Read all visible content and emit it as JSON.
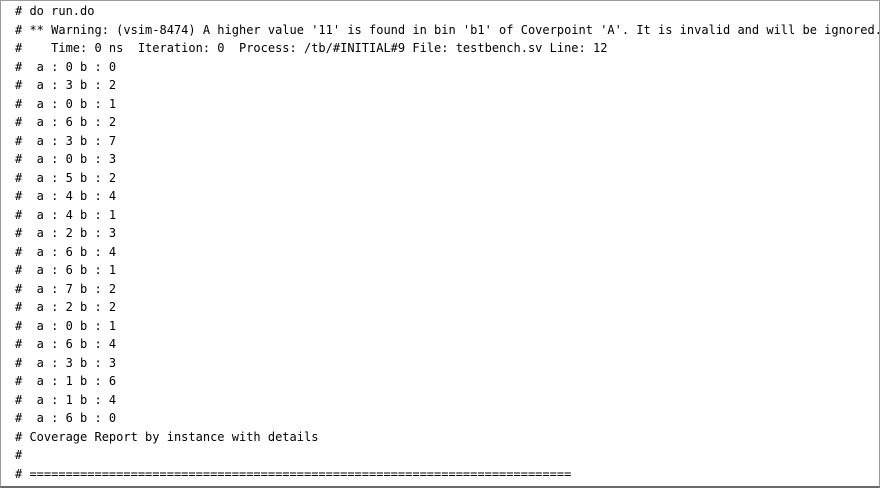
{
  "console": {
    "lines": [
      "# do run.do",
      "# ** Warning: (vsim-8474) A higher value '11' is found in bin 'b1' of Coverpoint 'A'. It is invalid and will be ignored.",
      "#    Time: 0 ns  Iteration: 0  Process: /tb/#INITIAL#9 File: testbench.sv Line: 12",
      "#  a : 0 b : 0",
      "#  a : 3 b : 2",
      "#  a : 0 b : 1",
      "#  a : 6 b : 2",
      "#  a : 3 b : 7",
      "#  a : 0 b : 3",
      "#  a : 5 b : 2",
      "#  a : 4 b : 4",
      "#  a : 4 b : 1",
      "#  a : 2 b : 3",
      "#  a : 6 b : 4",
      "#  a : 6 b : 1",
      "#  a : 7 b : 2",
      "#  a : 2 b : 2",
      "#  a : 0 b : 1",
      "#  a : 6 b : 4",
      "#  a : 3 b : 3",
      "#  a : 1 b : 6",
      "#  a : 1 b : 4",
      "#  a : 6 b : 0",
      "# Coverage Report by instance with details",
      "#",
      "# ==========================================================================="
    ]
  }
}
